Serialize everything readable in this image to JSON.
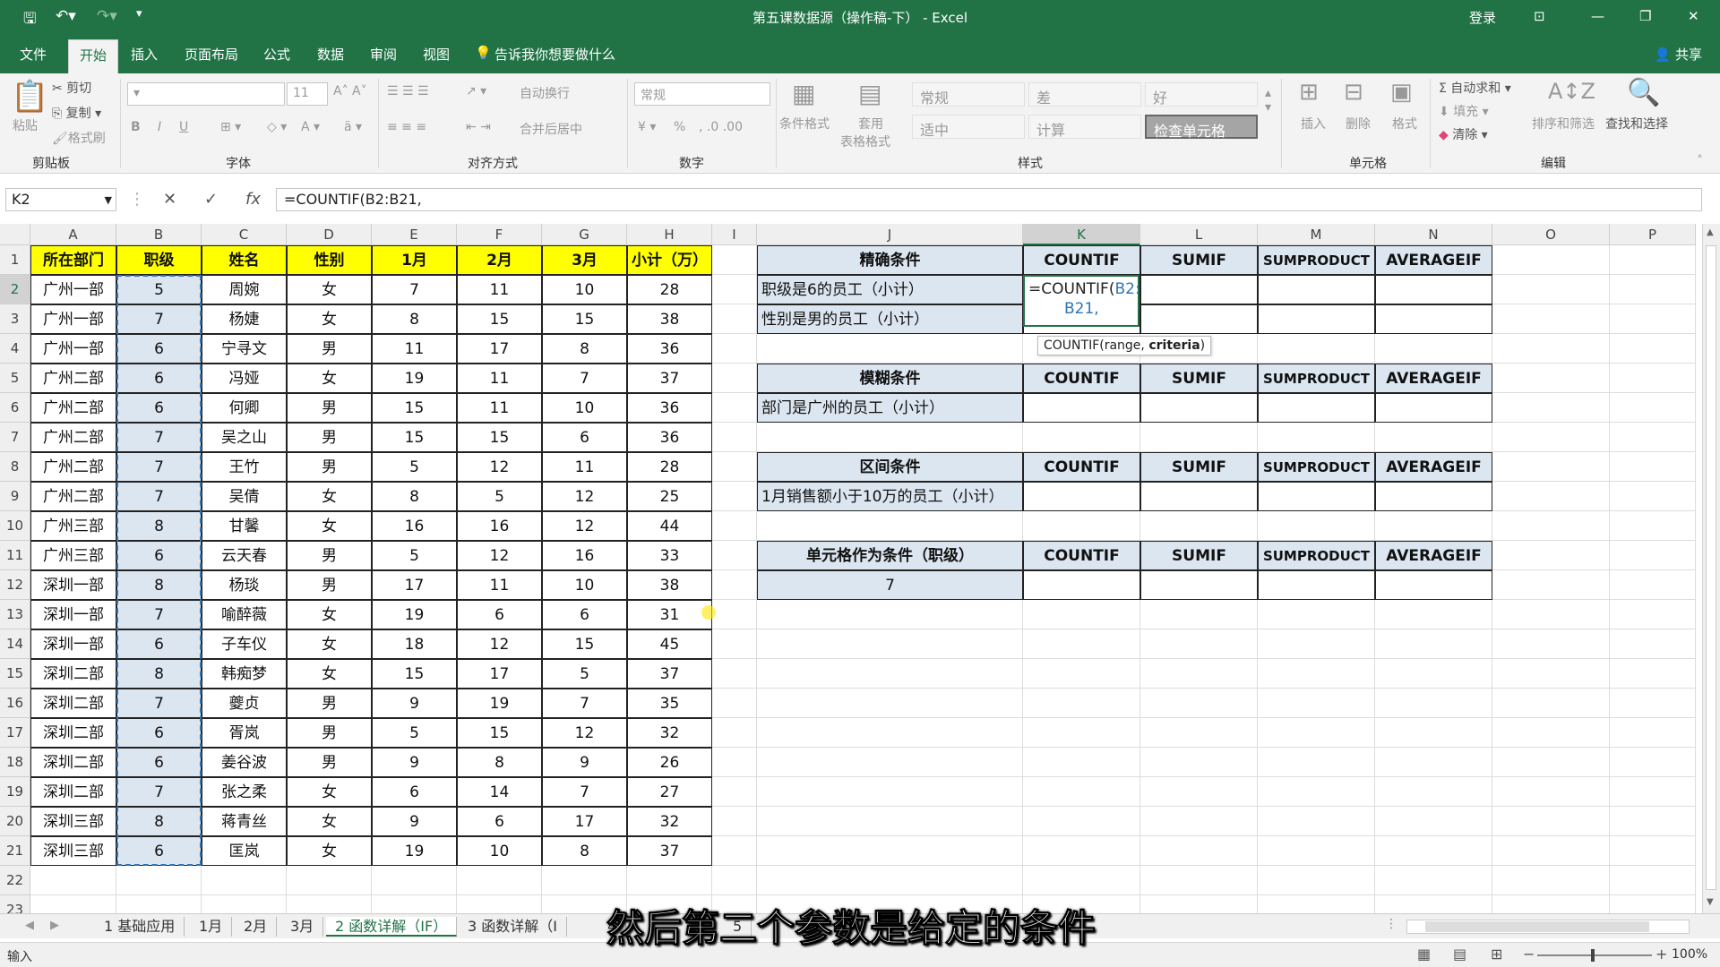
{
  "window": {
    "title": "第五课数据源（操作稿-下） - Excel",
    "login": "登录"
  },
  "menu": {
    "file": "文件",
    "tabs": [
      "开始",
      "插入",
      "页面布局",
      "公式",
      "数据",
      "审阅",
      "视图"
    ],
    "tell": "告诉我你想要做什么",
    "share": "共享"
  },
  "ribbon": {
    "paste": "粘贴",
    "cut": "剪切",
    "copy": "复制",
    "format_painter": "格式刷",
    "clipboard": "剪贴板",
    "font_group": "字体",
    "font_size": "11",
    "bold": "B",
    "italic": "I",
    "underline": "U",
    "align_group": "对齐方式",
    "wrap": "自动换行",
    "merge": "合并后居中",
    "number_group": "数字",
    "number_format": "常规",
    "percent": "%",
    "cond_format": "条件格式",
    "table_format_1": "套用",
    "table_format_2": "表格格式",
    "styles_group": "样式",
    "styles": [
      "常规",
      "差",
      "好",
      "适中",
      "计算",
      "检查单元格"
    ],
    "insert": "插入",
    "delete": "删除",
    "format": "格式",
    "cells_group": "单元格",
    "autosum": "自动求和",
    "fill": "填充",
    "clear": "清除",
    "sort": "排序和筛选",
    "find": "查找和选择",
    "edit_group": "编辑"
  },
  "formula_bar": {
    "name_box": "K2",
    "formula": "=COUNTIF(B2:B21,"
  },
  "columns": [
    "A",
    "B",
    "C",
    "D",
    "E",
    "F",
    "G",
    "H",
    "I",
    "J",
    "K",
    "L",
    "M",
    "N",
    "O",
    "P"
  ],
  "rows": [
    "1",
    "2",
    "3",
    "4",
    "5",
    "6",
    "7",
    "8",
    "9",
    "10",
    "11",
    "12",
    "13",
    "14",
    "15",
    "16",
    "17",
    "18",
    "19",
    "20",
    "21",
    "22",
    "23"
  ],
  "table": {
    "headers": [
      "所在部门",
      "职级",
      "姓名",
      "性别",
      "1月",
      "2月",
      "3月",
      "小计（万）"
    ],
    "data": [
      [
        "广州一部",
        "5",
        "周婉",
        "女",
        "7",
        "11",
        "10",
        "28"
      ],
      [
        "广州一部",
        "7",
        "杨婕",
        "女",
        "8",
        "15",
        "15",
        "38"
      ],
      [
        "广州一部",
        "6",
        "宁寻文",
        "男",
        "11",
        "17",
        "8",
        "36"
      ],
      [
        "广州二部",
        "6",
        "冯娅",
        "女",
        "19",
        "11",
        "7",
        "37"
      ],
      [
        "广州二部",
        "6",
        "何卿",
        "男",
        "15",
        "11",
        "10",
        "36"
      ],
      [
        "广州二部",
        "7",
        "吴之山",
        "男",
        "15",
        "15",
        "6",
        "36"
      ],
      [
        "广州二部",
        "7",
        "王竹",
        "男",
        "5",
        "12",
        "11",
        "28"
      ],
      [
        "广州二部",
        "7",
        "吴倩",
        "女",
        "8",
        "5",
        "12",
        "25"
      ],
      [
        "广州三部",
        "8",
        "甘馨",
        "女",
        "16",
        "16",
        "12",
        "44"
      ],
      [
        "广州三部",
        "6",
        "云天春",
        "男",
        "5",
        "12",
        "16",
        "33"
      ],
      [
        "深圳一部",
        "8",
        "杨琰",
        "男",
        "17",
        "11",
        "10",
        "38"
      ],
      [
        "深圳一部",
        "7",
        "喻醉薇",
        "女",
        "19",
        "6",
        "6",
        "31"
      ],
      [
        "深圳一部",
        "6",
        "子车仪",
        "女",
        "18",
        "12",
        "15",
        "45"
      ],
      [
        "深圳二部",
        "8",
        "韩痴梦",
        "女",
        "15",
        "17",
        "5",
        "37"
      ],
      [
        "深圳二部",
        "7",
        "夔贞",
        "男",
        "9",
        "19",
        "7",
        "35"
      ],
      [
        "深圳二部",
        "6",
        "胥岚",
        "男",
        "5",
        "15",
        "12",
        "32"
      ],
      [
        "深圳二部",
        "6",
        "姜谷波",
        "男",
        "9",
        "8",
        "9",
        "26"
      ],
      [
        "深圳二部",
        "7",
        "张之柔",
        "女",
        "6",
        "14",
        "7",
        "27"
      ],
      [
        "深圳三部",
        "8",
        "蒋青丝",
        "女",
        "9",
        "6",
        "17",
        "32"
      ],
      [
        "深圳三部",
        "6",
        "匡岚",
        "女",
        "19",
        "10",
        "8",
        "37"
      ]
    ]
  },
  "cond": {
    "fn": [
      "COUNTIF",
      "SUMIF",
      "SUMPRODUCT",
      "AVERAGEIF"
    ],
    "exact": "精确条件",
    "exact_r1": "职级是6的员工（小计）",
    "exact_r2": "性别是男的员工（小计）",
    "fuzzy": "模糊条件",
    "fuzzy_r1": "部门是广州的员工（小计）",
    "range": "区间条件",
    "range_r1": "1月销售额小于10万的员工（小计）",
    "cellcond": "单元格作为条件（职级）",
    "cellcond_r1": "7"
  },
  "editing": {
    "text_a": "=COUNTIF(",
    "text_b": "B2:",
    "text_c": "B21,",
    "tooltip_fn": "COUNTIF(range, ",
    "tooltip_arg": "criteria"
  },
  "sheet_tabs": [
    "1 基础应用",
    "1月",
    "2月",
    "3月",
    "2 函数详解（IF）",
    "3 函数详解（I",
    "4",
    "数",
    "5"
  ],
  "status": {
    "mode": "输入",
    "zoom": "100%"
  },
  "subtitle": "然后第二个参数是给定的条件",
  "colors": {
    "excel_green": "#217346",
    "header_yellow": "#ffff00",
    "header_blue": "#dce6f1"
  }
}
